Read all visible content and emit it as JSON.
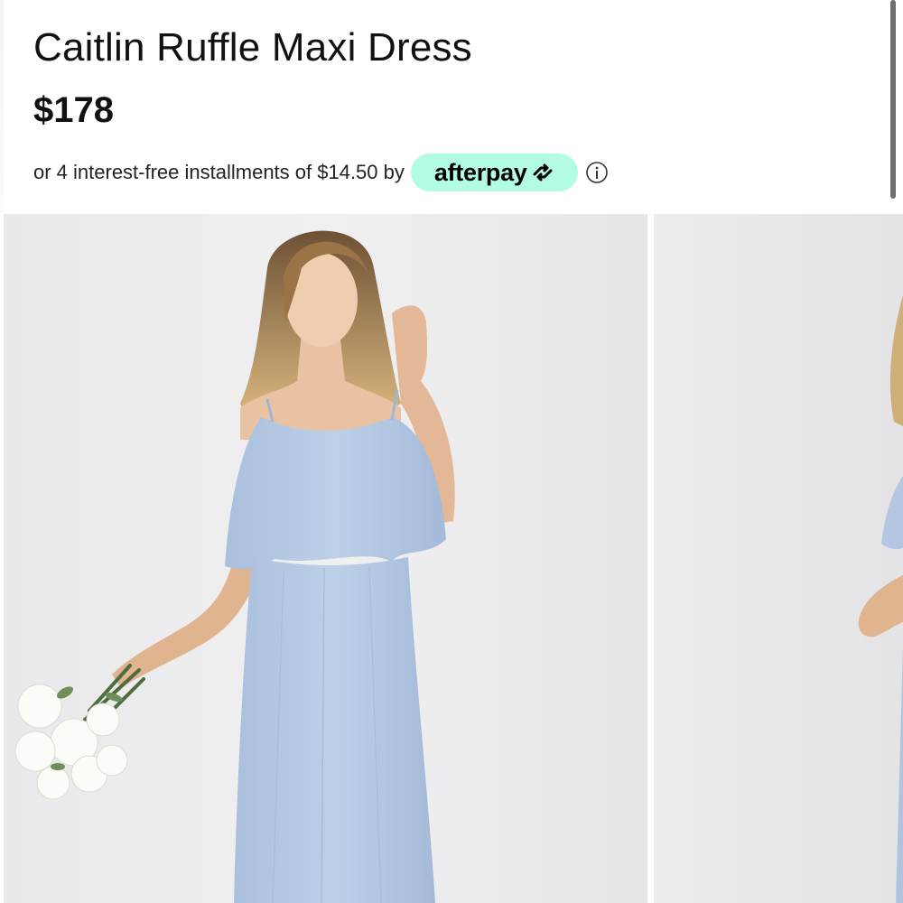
{
  "product": {
    "title": "Caitlin Ruffle Maxi Dress",
    "price": "$178"
  },
  "payment": {
    "installment_text": "or 4 interest-free installments of $14.50 by",
    "provider": "afterpay",
    "provider_icon": "afterpay-arrows-icon",
    "badge_color": "#b2fce4",
    "info_icon": "info-icon"
  },
  "gallery": {
    "images": [
      {
        "name": "model-front-photo"
      },
      {
        "name": "model-side-photo"
      }
    ]
  }
}
